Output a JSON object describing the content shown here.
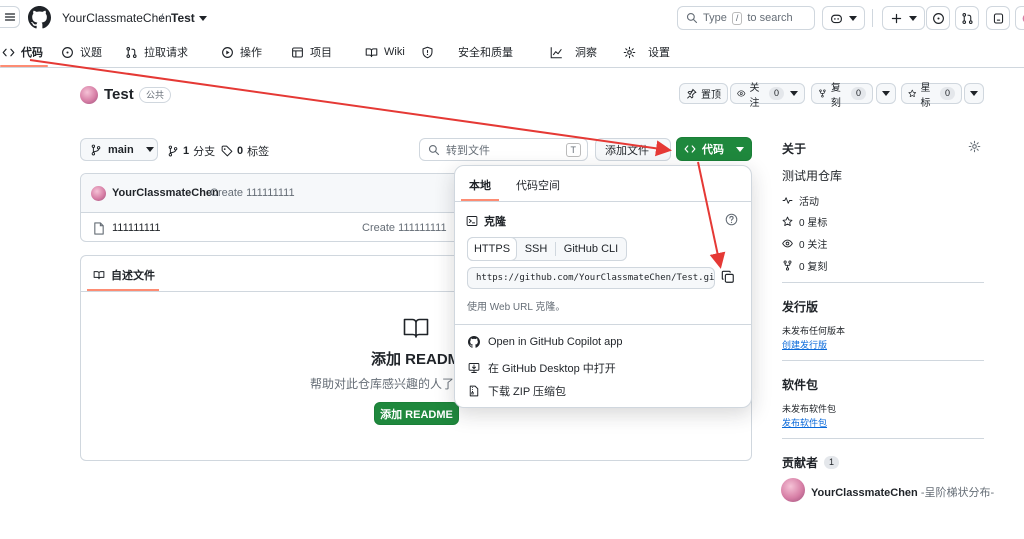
{
  "header": {
    "owner": "YourClassmateChen",
    "separator": "/",
    "repo": "Test",
    "search_placeholder": "Type",
    "search_key": "/",
    "search_suffix": "to search"
  },
  "nav": {
    "tabs": [
      {
        "label": "代码",
        "icon": "code-icon"
      },
      {
        "label": "议题",
        "icon": "issue-icon"
      },
      {
        "label": "拉取请求",
        "icon": "pull-request-icon"
      },
      {
        "label": "操作",
        "icon": "play-icon"
      },
      {
        "label": "项目",
        "icon": "table-icon"
      },
      {
        "label": "Wiki",
        "icon": "book-icon"
      },
      {
        "label": "安全和质量",
        "icon": "shield-icon"
      },
      {
        "label": "洞察",
        "icon": "graph-icon"
      },
      {
        "label": "设置",
        "icon": "gear-icon"
      }
    ]
  },
  "repo_head": {
    "name": "Test",
    "visibility": "公共",
    "pin_label": "置顶",
    "watch_label": "关注",
    "watch_count": "0",
    "fork_label": "复刻",
    "fork_count": "0",
    "star_label": "星标",
    "star_count": "0"
  },
  "branch_bar": {
    "branch": "main",
    "branches": "1",
    "branches_label": "分支",
    "tags": "0",
    "tags_label": "标签",
    "goto_placeholder": "转到文件",
    "goto_key": "T",
    "add_file_label": "添加文件",
    "code_label": "代码"
  },
  "files": {
    "commit_author": "YourClassmateChen",
    "commit_message": "Create 111111111",
    "rows": [
      {
        "name": "111111111",
        "commit": "Create 111111111"
      }
    ]
  },
  "readme": {
    "tab_label": "自述文件",
    "title": "添加 README",
    "description": "帮助对此仓库感兴趣的人了解",
    "button_label": "添加 README"
  },
  "code_panel": {
    "tabs": [
      "本地",
      "代码空间"
    ],
    "clone_title": "克隆",
    "protocols": [
      "HTTPS",
      "SSH",
      "GitHub CLI"
    ],
    "clone_url": "https://github.com/YourClassmateChen/Test.git",
    "hint": "使用 Web URL 克隆。",
    "options": [
      {
        "label": "Open in GitHub Copilot app",
        "icon": "copilot-icon"
      },
      {
        "label": "在 GitHub Desktop 中打开",
        "icon": "desktop-download-icon"
      },
      {
        "label": "下载 ZIP 压缩包",
        "icon": "file-zip-icon"
      }
    ]
  },
  "sidebar": {
    "about_title": "关于",
    "description": "测试用仓库",
    "stats": [
      {
        "label": "活动",
        "icon": "pulse-icon"
      },
      {
        "label": "0 星标",
        "icon": "star-icon"
      },
      {
        "label": "0 关注",
        "icon": "eye-icon"
      },
      {
        "label": "0 复刻",
        "icon": "fork-icon"
      }
    ],
    "releases_title": "发行版",
    "releases_note": "未发布任何版本",
    "releases_link": "创建发行版",
    "packages_title": "软件包",
    "packages_note": "未发布软件包",
    "packages_link": "发布软件包",
    "contributors_title": "贡献者",
    "contributors_count": "1",
    "contributor_name": "YourClassmateChen",
    "contributor_alias": " -呈阶梯状分布-"
  },
  "colors": {
    "accent_green": "#1f883d",
    "tab_underline": "#fd8c73",
    "annotation_red": "#e53935",
    "link_blue": "#0969da"
  }
}
